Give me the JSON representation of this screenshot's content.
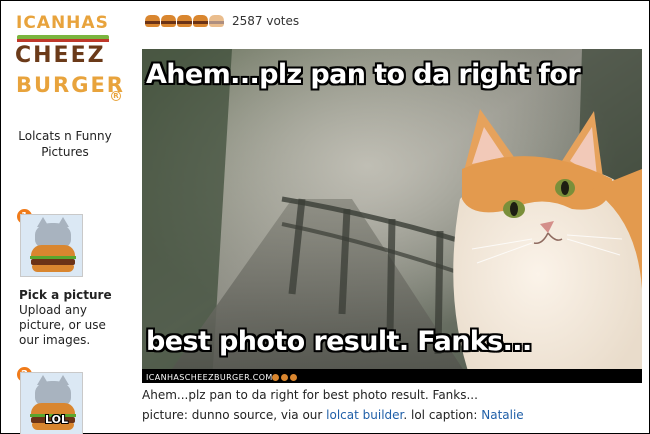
{
  "sidebar": {
    "logo": {
      "line1": "ICANHAS",
      "line2": "CHEEZ",
      "line3": "BURGER",
      "registered": "R"
    },
    "tagline": "Lolcats n Funny Pictures",
    "steps": [
      {
        "number": "1",
        "title": "Pick a picture",
        "description": "Upload any picture, or use our images."
      },
      {
        "number": "2",
        "thumb_label": "LOL"
      }
    ]
  },
  "post": {
    "rating_icons": [
      "cheezburger-icon",
      "cheezburger-icon",
      "cheezburger-icon",
      "cheezburger-icon",
      "cheezburger-half-icon"
    ],
    "votes": "2587 votes",
    "image": {
      "caption_top": "Ahem...plz pan to da right for",
      "caption_bottom": "best photo result. Fanks...",
      "watermark": "ICANHASCHEEZBURGER.COM"
    },
    "caption": "Ahem...plz pan to da right for best photo result. Fanks...",
    "credit": {
      "prefix": "picture: dunno source, via our",
      "builder_link": "lolcat builder",
      "middle": ". lol caption:",
      "author_link": "Natalie"
    }
  },
  "colors": {
    "accent_orange": "#f07b1a",
    "link_blue": "#1f5fa8",
    "logo_brown": "#6b3a19",
    "logo_gold": "#e8a33c"
  }
}
